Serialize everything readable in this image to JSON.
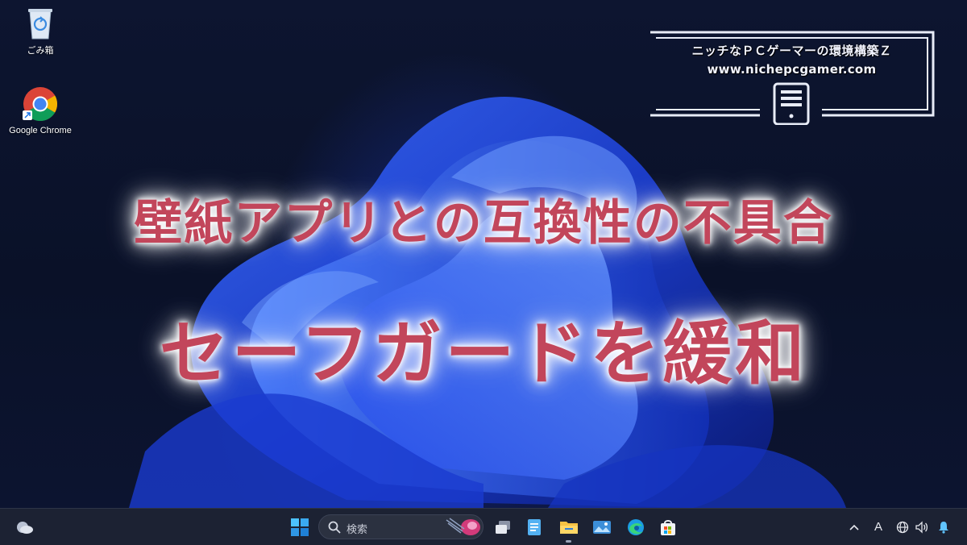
{
  "desktop": {
    "icons": [
      {
        "label": "ごみ箱",
        "icon": "recycle-bin-icon"
      },
      {
        "label": "Google Chrome",
        "icon": "chrome-icon"
      }
    ]
  },
  "logo": {
    "line1": "ニッチなＰＣゲーマーの環境構築Ｚ",
    "line2": "www.nichepcgamer.com"
  },
  "headline": {
    "line1": "壁紙アプリとの互換性の不具合",
    "line2": "セーフガードを緩和",
    "color": "#c2465b"
  },
  "taskbar": {
    "search_label": "検索",
    "tray_ime": "A",
    "apps": [
      "start-icon",
      "task-view-icon",
      "notepad-icon",
      "file-explorer-icon",
      "photos-icon",
      "edge-icon",
      "store-icon"
    ],
    "tray_icons": [
      "chevron-up-icon",
      "globe-icon",
      "speaker-icon",
      "notification-bell-icon"
    ],
    "widgets_icon": "weather-icon"
  }
}
